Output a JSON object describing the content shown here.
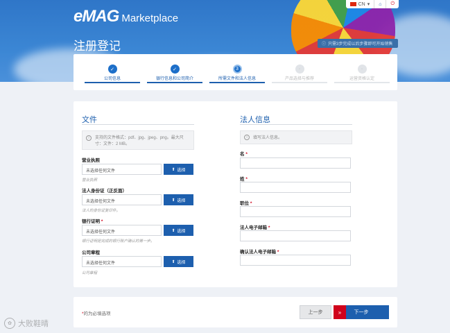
{
  "header": {
    "brand": "eMAG",
    "brand_suffix": "Marketplace",
    "page_title": "注册登记",
    "notice": "只需3步完成以后步骤即可开始销售",
    "topbar": {
      "lang": "CN",
      "home_icon": "home-icon",
      "power_icon": "power-icon"
    }
  },
  "steps": [
    {
      "label": "公司信息",
      "state": "done"
    },
    {
      "label": "银行信息和公司简介",
      "state": "done"
    },
    {
      "label": "所需文件和法人信息",
      "state": "active",
      "number": "3"
    },
    {
      "label": "产品选择与推荐",
      "state": "todo"
    },
    {
      "label": "运营资格认定",
      "state": "todo"
    }
  ],
  "documents": {
    "title": "文件",
    "info": "支持的文件格式：pdf、jpg、jpeg、png。最大尺寸：文件：2 MB。",
    "fields": [
      {
        "label": "营业执照",
        "required": false,
        "value": "未选择任何文件",
        "button": "选择",
        "hint": "营业执照"
      },
      {
        "label": "法人身份证（正反面）",
        "required": false,
        "value": "未选择任何文件",
        "button": "选择",
        "hint": "法人的身份证复印件。"
      },
      {
        "label": "银行证明",
        "required": true,
        "value": "未选择任何文件",
        "button": "选择",
        "hint": "银行证明是完成的银行账户确认的第一步。"
      },
      {
        "label": "公司章程",
        "required": false,
        "value": "未选择任何文件",
        "button": "选择",
        "hint": "公司章程"
      }
    ]
  },
  "legal": {
    "title": "法人信息",
    "info": "填写法人信息。",
    "fields": [
      {
        "label": "名",
        "required": true
      },
      {
        "label": "姓",
        "required": true
      },
      {
        "label": "职位",
        "required": true
      },
      {
        "label": "法人电子邮箱",
        "required": true
      },
      {
        "label": "确认法人电子邮箱",
        "required": true
      }
    ]
  },
  "footer": {
    "required_star": "*",
    "required_note": "的为必填选项",
    "prev": "上一步",
    "next": "下一步"
  },
  "watermark": {
    "text": "大败鞋晴"
  }
}
